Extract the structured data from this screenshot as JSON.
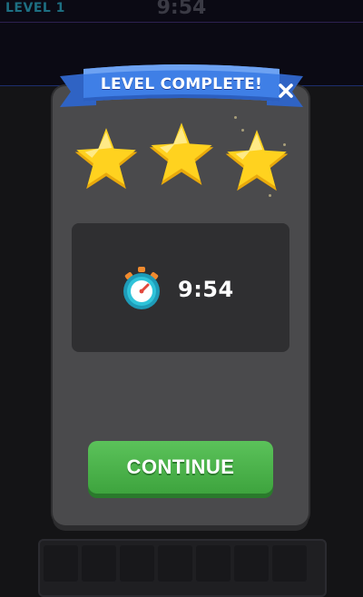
{
  "hud": {
    "level_label": "LEVEL 1",
    "timer": "9:54"
  },
  "modal": {
    "title": "LEVEL COMPLETE!",
    "close_icon": "close-icon",
    "stars_earned": 3,
    "stars_total": 3,
    "time_icon": "stopwatch-icon",
    "time_value": "9:54",
    "continue_label": "CONTINUE"
  },
  "colors": {
    "ribbon": "#3f7fe6",
    "star": "#ffcc1a",
    "button": "#4bb34a",
    "panel": "#4a4a4c"
  }
}
